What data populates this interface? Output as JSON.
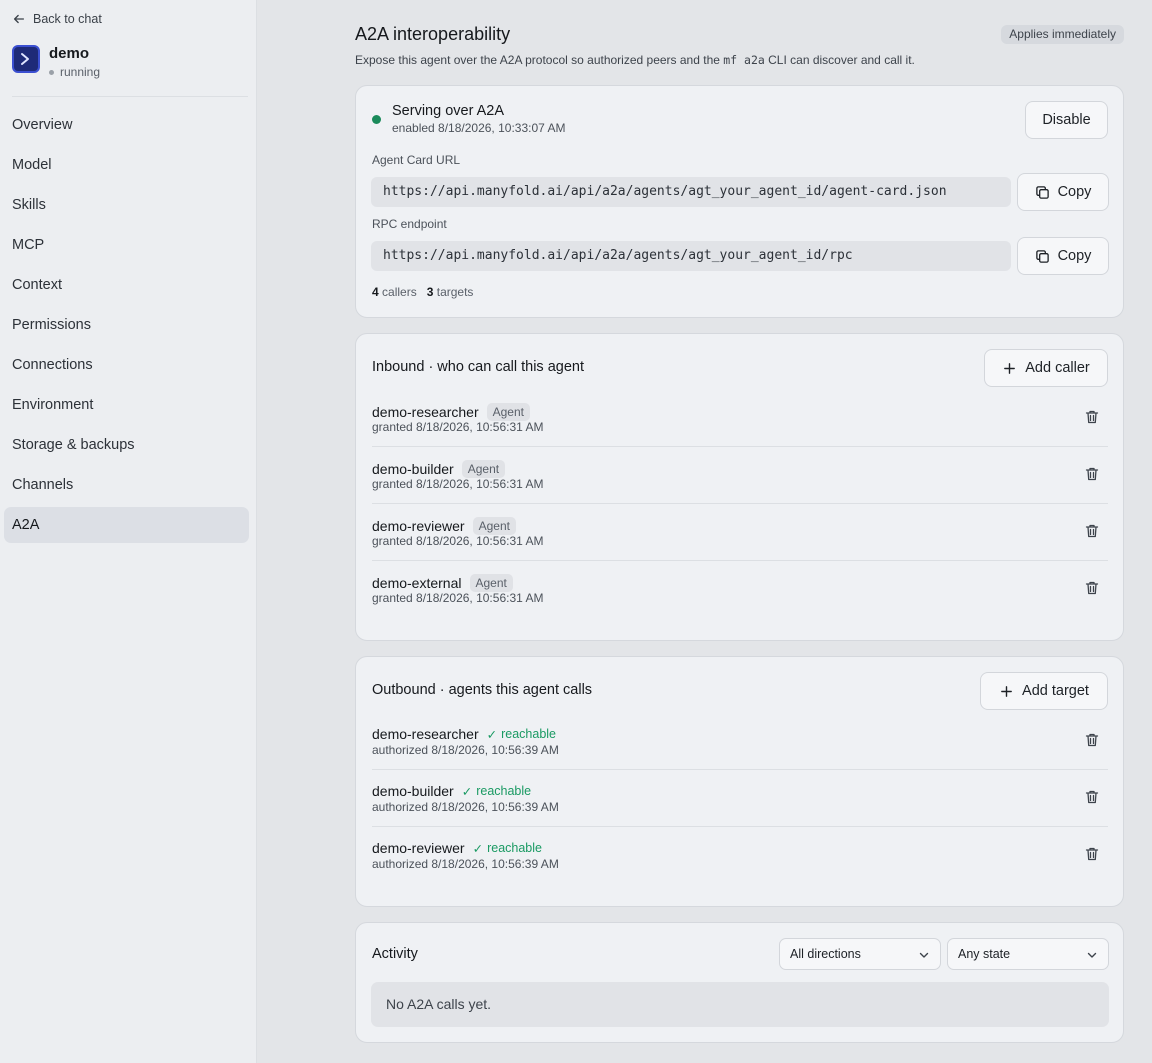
{
  "sidebar": {
    "back_label": "Back to chat",
    "agent_name": "demo",
    "agent_status": "running",
    "items": [
      {
        "label": "Overview"
      },
      {
        "label": "Model"
      },
      {
        "label": "Skills"
      },
      {
        "label": "MCP"
      },
      {
        "label": "Context"
      },
      {
        "label": "Permissions"
      },
      {
        "label": "Connections"
      },
      {
        "label": "Environment"
      },
      {
        "label": "Storage & backups"
      },
      {
        "label": "Channels"
      },
      {
        "label": "A2A",
        "active": true
      }
    ]
  },
  "header": {
    "title": "A2A interoperability",
    "badge": "Applies immediately",
    "desc_before": "Expose this agent over the A2A protocol so authorized peers and the ",
    "desc_code": "mf a2a",
    "desc_after": " CLI can discover and call it."
  },
  "serving": {
    "title": "Serving over A2A",
    "subtitle": "enabled 8/18/2026, 10:33:07 AM",
    "status_color": "#1a8a5a",
    "disable_label": "Disable",
    "agent_card_label": "Agent Card URL",
    "agent_card_url": "https://api.manyfold.ai/api/a2a/agents/agt_your_agent_id/agent-card.json",
    "rpc_label": "RPC endpoint",
    "rpc_url": "https://api.manyfold.ai/api/a2a/agents/agt_your_agent_id/rpc",
    "copy_label": "Copy",
    "callers_count": "4",
    "callers_label": "callers",
    "targets_count": "3",
    "targets_label": "targets"
  },
  "inbound": {
    "title": "Inbound · who can call this agent",
    "add_label": "Add caller",
    "rows": [
      {
        "name": "demo-researcher",
        "tag": "Agent",
        "sub": "granted 8/18/2026, 10:56:31 AM"
      },
      {
        "name": "demo-builder",
        "tag": "Agent",
        "sub": "granted 8/18/2026, 10:56:31 AM"
      },
      {
        "name": "demo-reviewer",
        "tag": "Agent",
        "sub": "granted 8/18/2026, 10:56:31 AM"
      },
      {
        "name": "demo-external",
        "tag": "Agent",
        "sub": "granted 8/18/2026, 10:56:31 AM"
      }
    ]
  },
  "outbound": {
    "title": "Outbound · agents this agent calls",
    "add_label": "Add target",
    "rows": [
      {
        "name": "demo-researcher",
        "status": "reachable",
        "sub": "authorized 8/18/2026, 10:56:39 AM"
      },
      {
        "name": "demo-builder",
        "status": "reachable",
        "sub": "authorized 8/18/2026, 10:56:39 AM"
      },
      {
        "name": "demo-reviewer",
        "status": "reachable",
        "sub": "authorized 8/18/2026, 10:56:39 AM"
      }
    ],
    "reachable_color": "#1a9a63"
  },
  "activity": {
    "title": "Activity",
    "direction_selected": "All directions",
    "state_selected": "Any state",
    "empty": "No A2A calls yet."
  }
}
